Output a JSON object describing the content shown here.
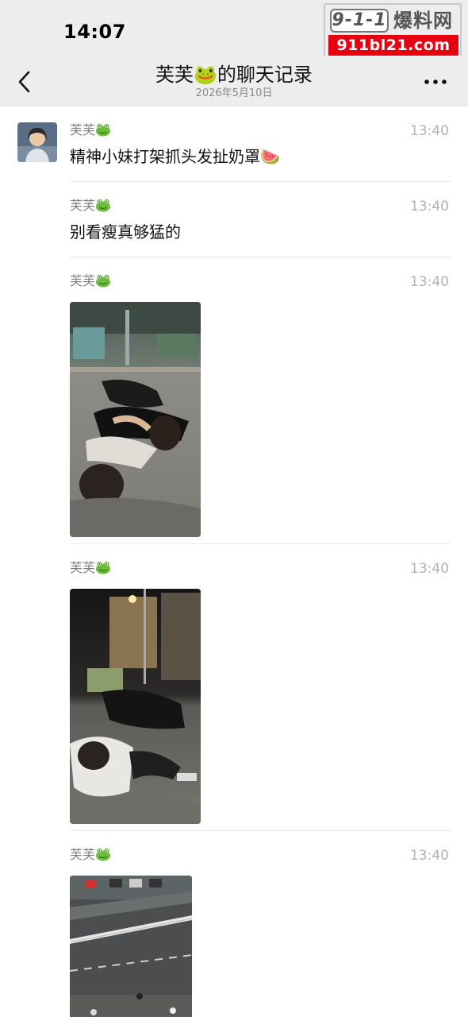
{
  "status_bar": {
    "time": "14:07"
  },
  "watermark": {
    "logo": "9-1-1",
    "side": "爆料网",
    "url": "911bl21.com"
  },
  "nav": {
    "title": "芙芙🐸的聊天记录",
    "subtitle": "2026年5月10日"
  },
  "messages": [
    {
      "sender": "芙芙",
      "time": "13:40",
      "text": "精神小妹打架抓头发扯奶罩🍉"
    },
    {
      "sender": "芙芙",
      "time": "13:40",
      "text": "别看瘦真够猛的"
    },
    {
      "sender": "芙芙",
      "time": "13:40",
      "image": "photo-fight-street-1"
    },
    {
      "sender": "芙芙",
      "time": "13:40",
      "image": "photo-fight-street-2"
    },
    {
      "sender": "芙芙",
      "time": "13:40",
      "image": "photo-street-aerial"
    }
  ],
  "colors": {
    "nav_bg": "#ededed",
    "watermark_red": "#e60012"
  }
}
